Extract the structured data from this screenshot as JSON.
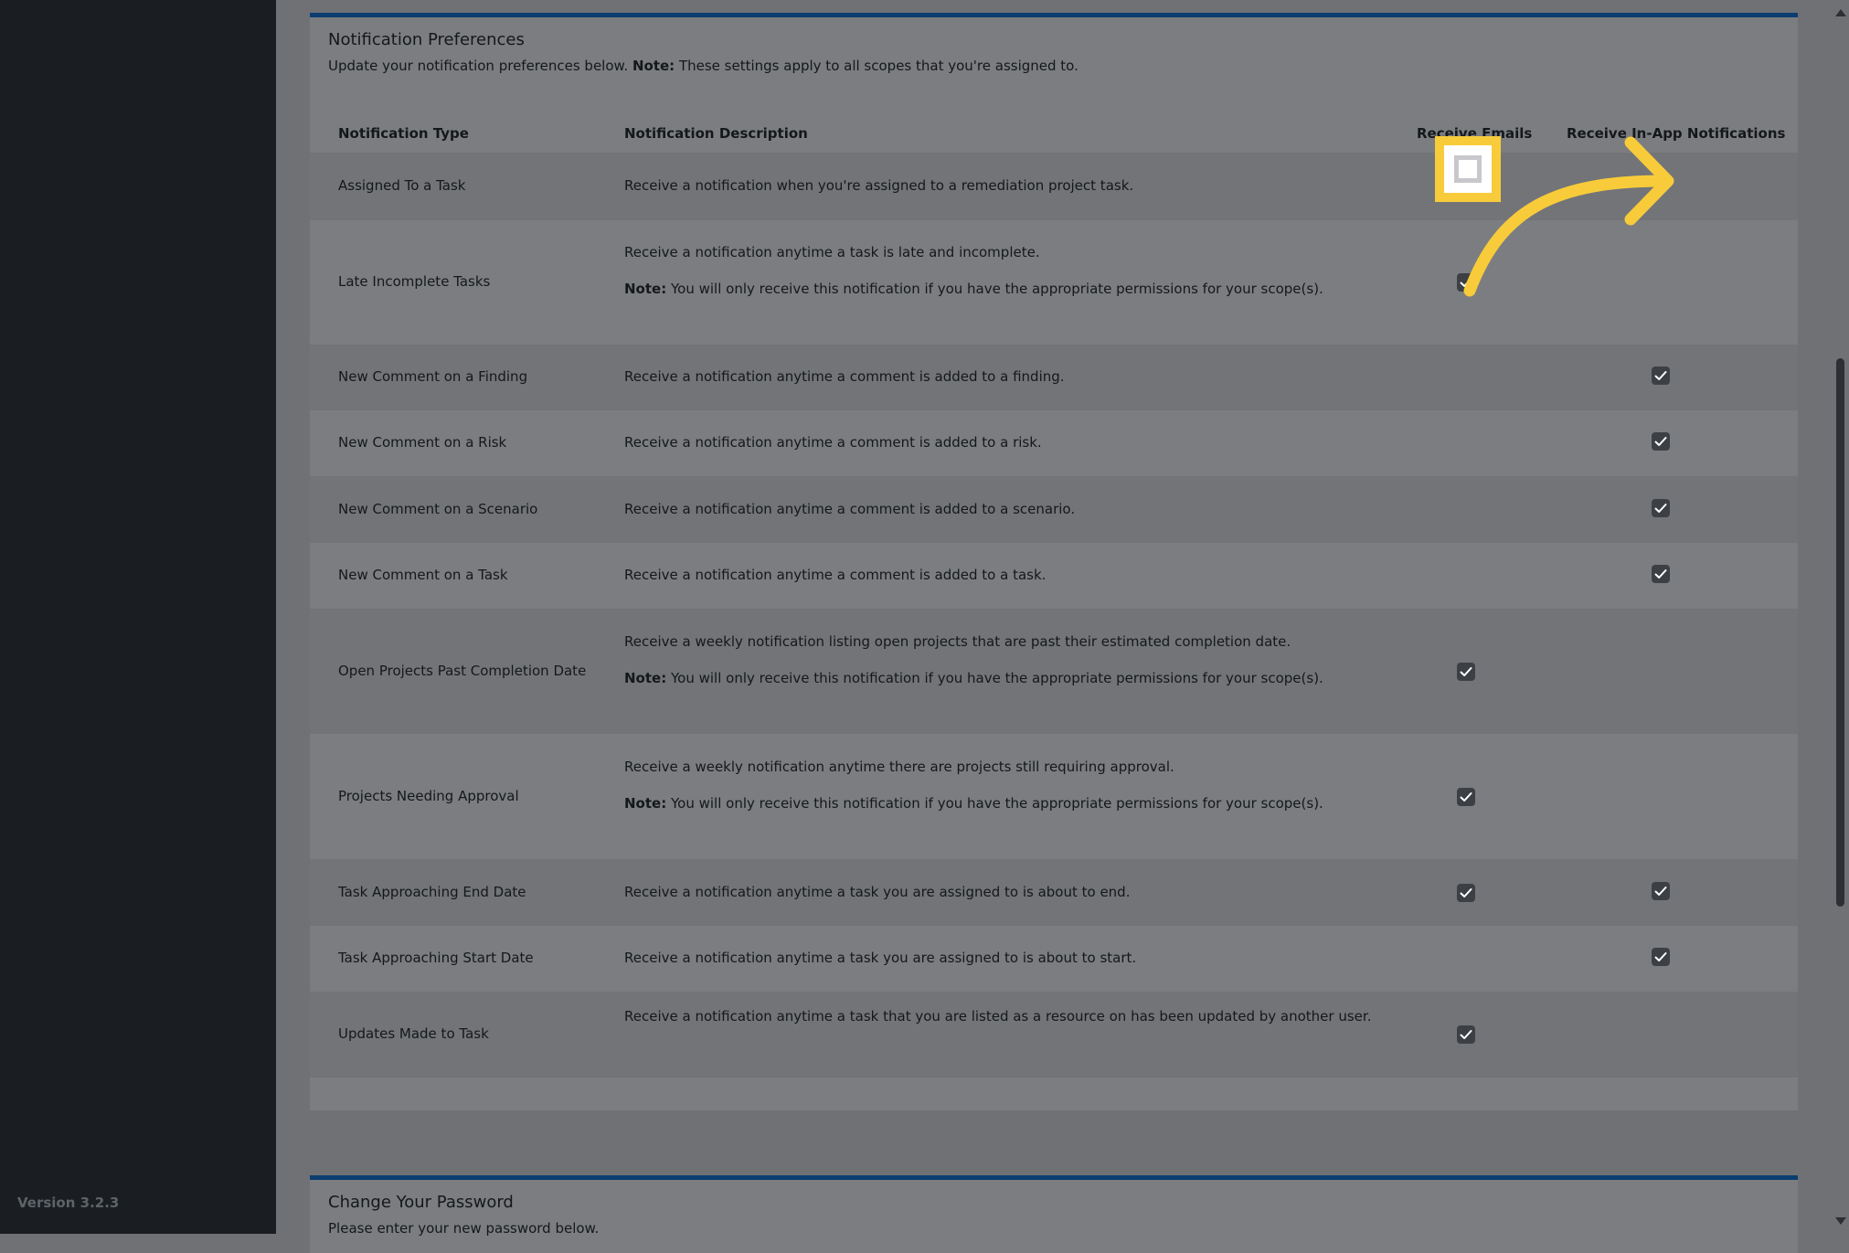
{
  "sidebar": {
    "version": "Version 3.2.3"
  },
  "prefs": {
    "title": "Notification Preferences",
    "subtitle_prefix": "Update your notification preferences below.",
    "subtitle_note_label": "Note:",
    "subtitle_note_text": "These settings apply to all scopes that you're assigned to.",
    "headers": {
      "type": "Notification Type",
      "description": "Notification Description",
      "email": "Receive Emails",
      "in_app": "Receive In-App Notifications"
    },
    "note_label": "Note:",
    "rows": [
      {
        "type": "Assigned To a Task",
        "description": "Receive a notification when you're assigned to a remediation project task.",
        "note": "",
        "email": false,
        "in_app": false
      },
      {
        "type": "Late Incomplete Tasks",
        "description": "Receive a notification anytime a task is late and incomplete.",
        "note": "You will only receive this notification if you have the appropriate permissions for your scope(s).",
        "email": true,
        "in_app": false
      },
      {
        "type": "New Comment on a Finding",
        "description": "Receive a notification anytime a comment is added to a finding.",
        "note": "",
        "email": false,
        "in_app": true
      },
      {
        "type": "New Comment on a Risk",
        "description": "Receive a notification anytime a comment is added to a risk.",
        "note": "",
        "email": false,
        "in_app": true
      },
      {
        "type": "New Comment on a Scenario",
        "description": "Receive a notification anytime a comment is added to a scenario.",
        "note": "",
        "email": false,
        "in_app": true
      },
      {
        "type": "New Comment on a Task",
        "description": "Receive a notification anytime a comment is added to a task.",
        "note": "",
        "email": false,
        "in_app": true
      },
      {
        "type": "Open Projects Past Completion Date",
        "description": "Receive a weekly notification listing open projects that are past their estimated completion date.",
        "note": "You will only receive this notification if you have the appropriate permissions for your scope(s).",
        "email": true,
        "in_app": false
      },
      {
        "type": "Projects Needing Approval",
        "description": "Receive a weekly notification anytime there are projects still requiring approval.",
        "note": "You will only receive this notification if you have the appropriate permissions for your scope(s).",
        "email": true,
        "in_app": false
      },
      {
        "type": "Task Approaching End Date",
        "description": "Receive a notification anytime a task you are assigned to is about to end.",
        "note": "",
        "email": true,
        "in_app": true
      },
      {
        "type": "Task Approaching Start Date",
        "description": "Receive a notification anytime a task you are assigned to is about to start.",
        "note": "",
        "email": false,
        "in_app": true
      },
      {
        "type": "Updates Made to Task",
        "description": "Receive a notification anytime a task that you are listed as a resource on has been updated by another user.",
        "note": "",
        "email": true,
        "in_app": false
      }
    ]
  },
  "password": {
    "title": "Change Your Password",
    "subtitle": "Please enter your new password below."
  },
  "colors": {
    "highlight": "#f8cb3a",
    "card_accent": "#0c3d70",
    "sidebar_bg": "#1a1e22"
  },
  "icons": {
    "check": "check-icon",
    "arrow": "curved-arrow-icon"
  }
}
